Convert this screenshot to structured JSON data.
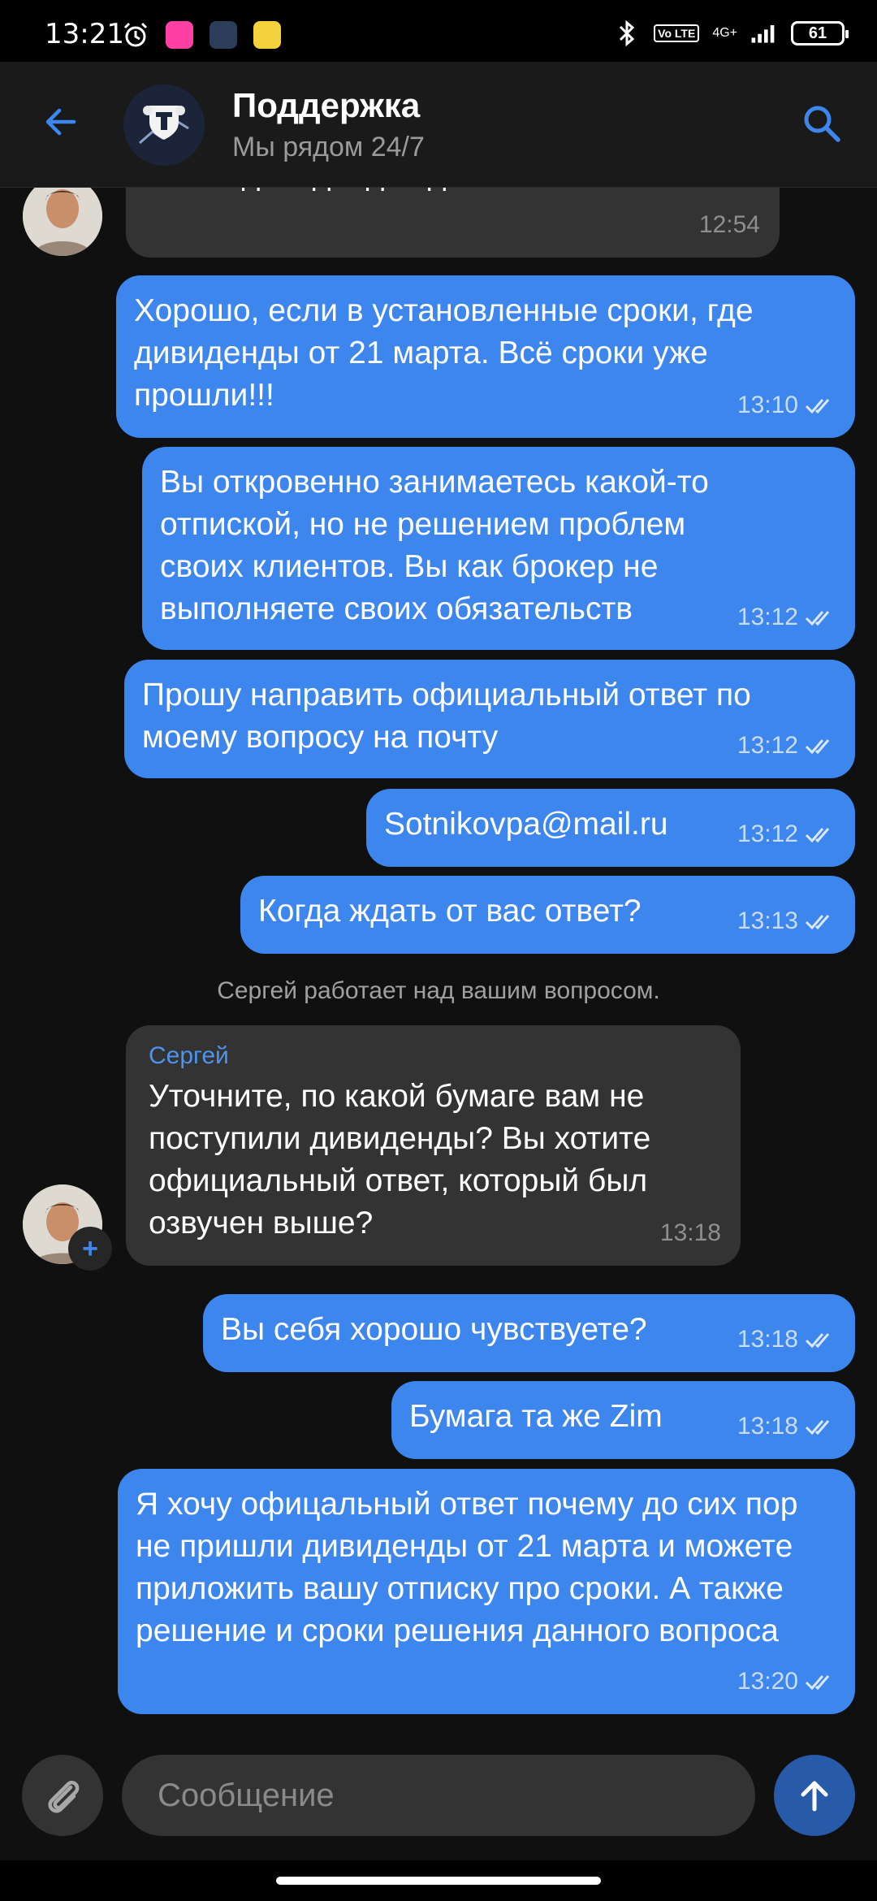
{
  "status_bar": {
    "time": "13:21",
    "battery": "61",
    "network": "4G+",
    "volte": "Vo LTE"
  },
  "header": {
    "title": "Поддержка",
    "subtitle": "Мы рядом 24/7"
  },
  "messages": [
    {
      "direction": "in",
      "text": "плата дивидендов данной компании",
      "time": "12:54"
    },
    {
      "direction": "out",
      "text": "Хорошо, если в установленные сроки, где дивиденды от 21 марта. Всё сроки уже прошли!!!",
      "time": "13:10"
    },
    {
      "direction": "out",
      "text": "Вы откровенно занимаетесь какой-то отпиской, но не решением проблем своих клиентов. Вы как брокер не выполняете своих обязательств",
      "time": "13:12"
    },
    {
      "direction": "out",
      "text": "Прошу направить официальный ответ по моему вопросу на почту",
      "time": "13:12"
    },
    {
      "direction": "out",
      "text": "Sotnikovpa@mail.ru",
      "time": "13:12"
    },
    {
      "direction": "out",
      "text": "Когда ждать от вас ответ?",
      "time": "13:13"
    },
    {
      "direction": "in",
      "sender": "Сергей",
      "text": "Уточните, по какой бумаге вам не поступили дивиденды? Вы хотите официальный ответ, который был озвучен выше?",
      "time": "13:18"
    },
    {
      "direction": "out",
      "text": "Вы себя хорошо чувствуете?",
      "time": "13:18"
    },
    {
      "direction": "out",
      "text": "Бумага та же Zim",
      "time": "13:18"
    },
    {
      "direction": "out",
      "text": "Я хочу офицальный ответ почему до сих пор не пришли дивиденды от 21 марта и можете приложить вашу отписку про сроки. А также решение и сроки решения данного вопроса",
      "time": "13:20"
    }
  ],
  "system_note": "Сергей  работает над вашим вопросом.",
  "composer": {
    "placeholder": "Сообщение"
  },
  "colors": {
    "accent": "#3d86ee",
    "incoming_bubble": "#333333",
    "background": "#101010"
  }
}
